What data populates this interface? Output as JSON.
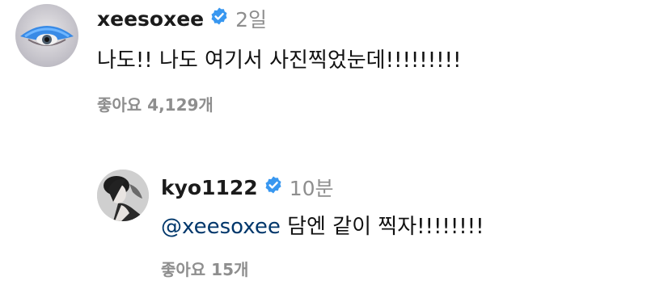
{
  "colors": {
    "verified_badge": "#3897f0",
    "muted_text": "#8e8e8e",
    "mention": "#00376b"
  },
  "comment": {
    "username": "xeesoxee",
    "verified": true,
    "time": "2일",
    "text": "나도!! 나도 여기서 사진찍었눈데!!!!!!!!!",
    "likes": "좋아요 4,129개"
  },
  "reply": {
    "username": "kyo1122",
    "verified": true,
    "time": "10분",
    "mention": "@xeesoxee",
    "text": "담엔 같이 찍자!!!!!!!!",
    "likes": "좋아요 15개"
  }
}
